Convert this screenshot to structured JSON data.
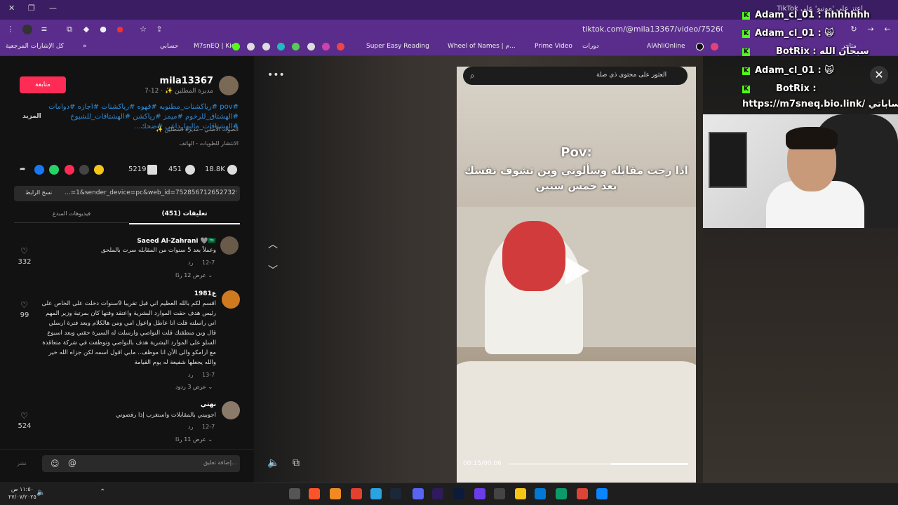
{
  "titlebar": {
    "tab_text": "اعتز على 'مونبو' على TikTok"
  },
  "toolbar": {
    "url": "tiktok.com/@mila13367/video/7526096701090712839"
  },
  "bookmarks": {
    "items": [
      "كل الإشارات المرجعية",
      "حسابي",
      "M7snEQ | Kick",
      "Super Easy Reading",
      "Wheel of Names | م...",
      "Prime Video",
      "دورات",
      "AlAhliOnline",
      "متاجر"
    ]
  },
  "post": {
    "follow_label": "متابعة",
    "username": "mila13367",
    "subline": "مديرة المطلين ✨ · 12-7",
    "hashtags": "#pov #رياكشنات_مطنوبه #قهوه #رياكشنات #اجازه #دوامات #الهشتاق_للرخوم #ميمز #رياكشن #الهشتاقات_للشيوخ #الهشتاقات_ماليها_داعي #ضحك...",
    "more": "المزيد",
    "music": "الصوت الأصلي - مديرة المطلين ✨",
    "badge": "الانتشار للطويات - الهاتف",
    "likes": "18.8K",
    "comments_count": "451",
    "saves": "5219",
    "link": "...=1&sender_device=pc&web_id=7528567126527329810",
    "copy_link": "نسخ الرابط",
    "tab_comments": "تعليقات (451)",
    "tab_creator": "فيديوهات المبدع"
  },
  "comments": [
    {
      "name": "Saeed Al-Zahrani 🩶🇸🇦",
      "text": "وعملاً بعد 5 سنوات من المقابله سرت بالملحق",
      "date": "12-7",
      "reply": "رد",
      "likes": "332",
      "view": "عرض 12 ردًا ⌄"
    },
    {
      "name": "ع1981",
      "text": "اقسم لكم بالله العظيم اني قبل تقريبا 9سنوات دخلت على الخاص على رئيس هدف حقت الموارد البشرية واعتقد وقتها كان بمرتبة وزير المهم اني راسلته قلت انا عاطل واعول امي ومن هالكلام وبعد فترة ارسلي قال وين منطقتك قلت النواصي وارسلت له السيرة حقتي وبعد اسبوع السلو على الموارد البشرية هدف بالنواصي وتوظفت في شركة متعاقدة مع ارامكو والى الآن انا موظف.. مابي اقول اسمه لكن جزاه الله خير والله يجعلها شفيعة له يوم القيامة",
      "date": "13-7",
      "reply": "رد",
      "likes": "99",
      "view": "عرض 3 ردود ⌄"
    },
    {
      "name": "نهتي",
      "text": "اجوبيتي بالمقابلات واستغرب إذا رفضوني",
      "date": "12-7",
      "reply": "رد",
      "likes": "524",
      "view": "عرض 11 ردًا ⌄"
    }
  ],
  "comment_bar": {
    "placeholder": "إضافة تعليق...",
    "post": "نشر"
  },
  "video": {
    "search_placeholder": "العثور على محتوى ذي صلة",
    "pov": "Pov:",
    "caption": "اذا رحت مقابله وسألوني وين تشوف نفسك بعد خمس سنين",
    "time": "00:15/00:06",
    "progress": 0.43
  },
  "chat": [
    {
      "text": "Adam_cl_01 : hhhhhhh"
    },
    {
      "text": "Adam_cl_01 : 🙀"
    },
    {
      "text": "BotRix : سبحان الله"
    },
    {
      "text": "Adam_cl_01 : 🙀"
    },
    {
      "text": "BotRix :"
    },
    {
      "text": "https://m7sneq.bio.link/ حساباتي"
    }
  ],
  "taskbar": {
    "time": "١١:٥٠ ص",
    "date": "٢٧/٠٧/٢٠٢٥"
  }
}
